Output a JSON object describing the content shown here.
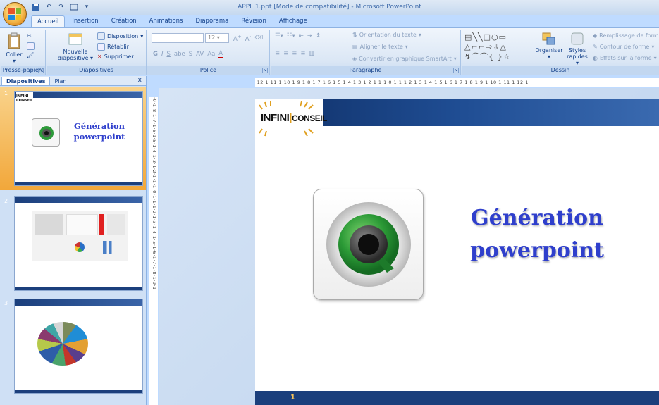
{
  "window": {
    "title": "APPLI1.ppt [Mode de compatibilité] - Microsoft PowerPoint"
  },
  "tabs": [
    "Accueil",
    "Insertion",
    "Création",
    "Animations",
    "Diaporama",
    "Révision",
    "Affichage"
  ],
  "ribbon": {
    "clipboard": {
      "paste": "Coller",
      "label": "Presse-papiers"
    },
    "slides": {
      "new_slide": "Nouvelle",
      "new_slide2": "diapositive",
      "layout": "Disposition",
      "reset": "Rétablir",
      "delete": "Supprimer",
      "label": "Diapositives"
    },
    "font": {
      "size": "12",
      "label": "Police"
    },
    "paragraph": {
      "text_direction": "Orientation du texte",
      "align_text": "Aligner le texte",
      "smartart": "Convertir en graphique SmartArt",
      "label": "Paragraphe"
    },
    "drawing": {
      "arrange": "Organiser",
      "quick_styles": "Styles",
      "quick_styles2": "rapides",
      "fill": "Remplissage de form",
      "outline": "Contour de forme",
      "effects": "Effets sur la forme",
      "label": "Dessin"
    }
  },
  "left_pane": {
    "tab_slides": "Diapositives",
    "tab_outline": "Plan",
    "close": "x",
    "thumbs": [
      {
        "num": "1",
        "title_line1": "Génération",
        "title_line2": "powerpoint"
      },
      {
        "num": "2"
      },
      {
        "num": "3"
      }
    ]
  },
  "ruler": {
    "h": "·12·1·11·1·10·1·9·1·8·1·7·1·6·1·5·1·4·1·3·1·2·1·1·1·0·1·1·1·2·1·3·1·4·1·5·1·6·1·7·1·8·1·9·1·10·1·11·1·12·1",
    "v": "·9·1·8·1·7·1·6·1·5·1·4·1·3·1·2·1·1·1·0·1·1·1·2·1·3·1·4·1·5·1·6·1·7·1·8·1·9·1"
  },
  "slide": {
    "logo_left": "INFINI",
    "logo_right": "CONSEIL",
    "title_line1": "Génération",
    "title_line2": "powerpoint",
    "number": "1"
  }
}
